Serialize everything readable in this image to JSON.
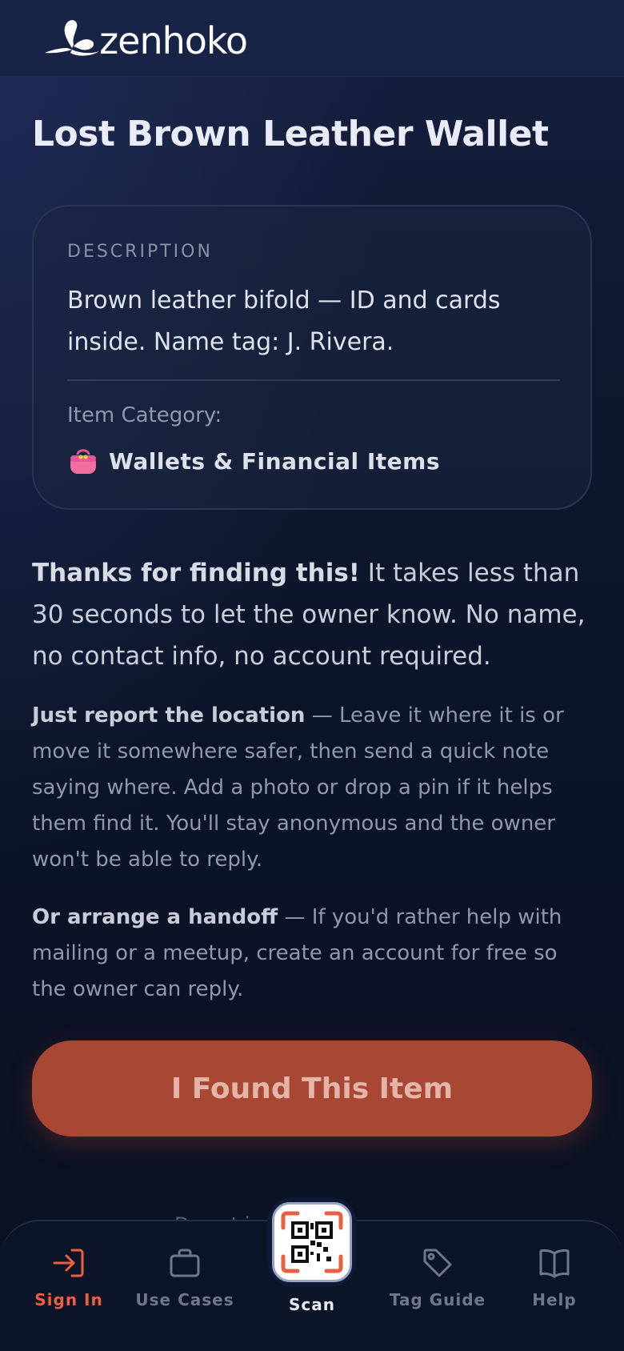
{
  "brand": {
    "name": "zenhoko",
    "logo_icon": "butterfly-icon"
  },
  "item": {
    "title": "Lost Brown Leather Wallet",
    "description_label": "DESCRIPTION",
    "description": "Brown leather bifold — ID and cards inside. Name tag: J. Rivera.",
    "category_label": "Item Category:",
    "category_icon": "purse-icon",
    "category": "Wallets & Financial Items"
  },
  "instructions": {
    "intro_bold": "Thanks for finding this!",
    "intro_rest": " It takes less than 30 seconds to let the owner know. No name, no contact info, no account required.",
    "report_bold": "Just report the location",
    "report_rest": " — Leave it where it is or move it somewhere safer, then send a quick note saying where. Add a photo or drop a pin if it helps them find it. You'll stay anonymous and the owner won't be able to reply.",
    "handoff_bold": "Or arrange a handoff",
    "handoff_rest": " — If you'd rather help with mailing or a meetup, create an account for free so the owner can reply."
  },
  "actions": {
    "found_button": "I Found This Item"
  },
  "footer_peek": "Do not ina                te c",
  "bottom_nav": {
    "sign_in": "Sign In",
    "use_cases": "Use Cases",
    "scan": "Scan",
    "tag_guide": "Tag Guide",
    "help": "Help",
    "active": "sign_in"
  },
  "colors": {
    "accent": "#e8603f",
    "button_bg": "#a84834",
    "background": "#0c1426",
    "header_bg": "#172445"
  }
}
